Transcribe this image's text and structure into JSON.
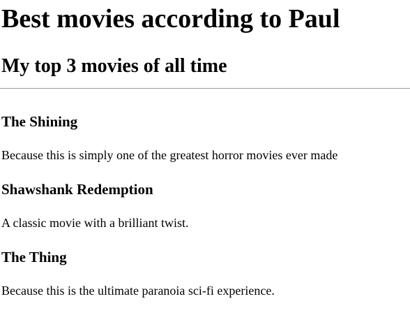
{
  "page": {
    "title": "Best movies according to Paul",
    "subtitle": "My top 3 movies of all time"
  },
  "movies": [
    {
      "title": "The Shining",
      "description": "Because this is simply one of the greatest horror movies ever made"
    },
    {
      "title": "Shawshank Redemption",
      "description": "A classic movie with a brilliant twist."
    },
    {
      "title": "The Thing",
      "description": "Because this is the ultimate paranoia sci-fi experience."
    }
  ]
}
